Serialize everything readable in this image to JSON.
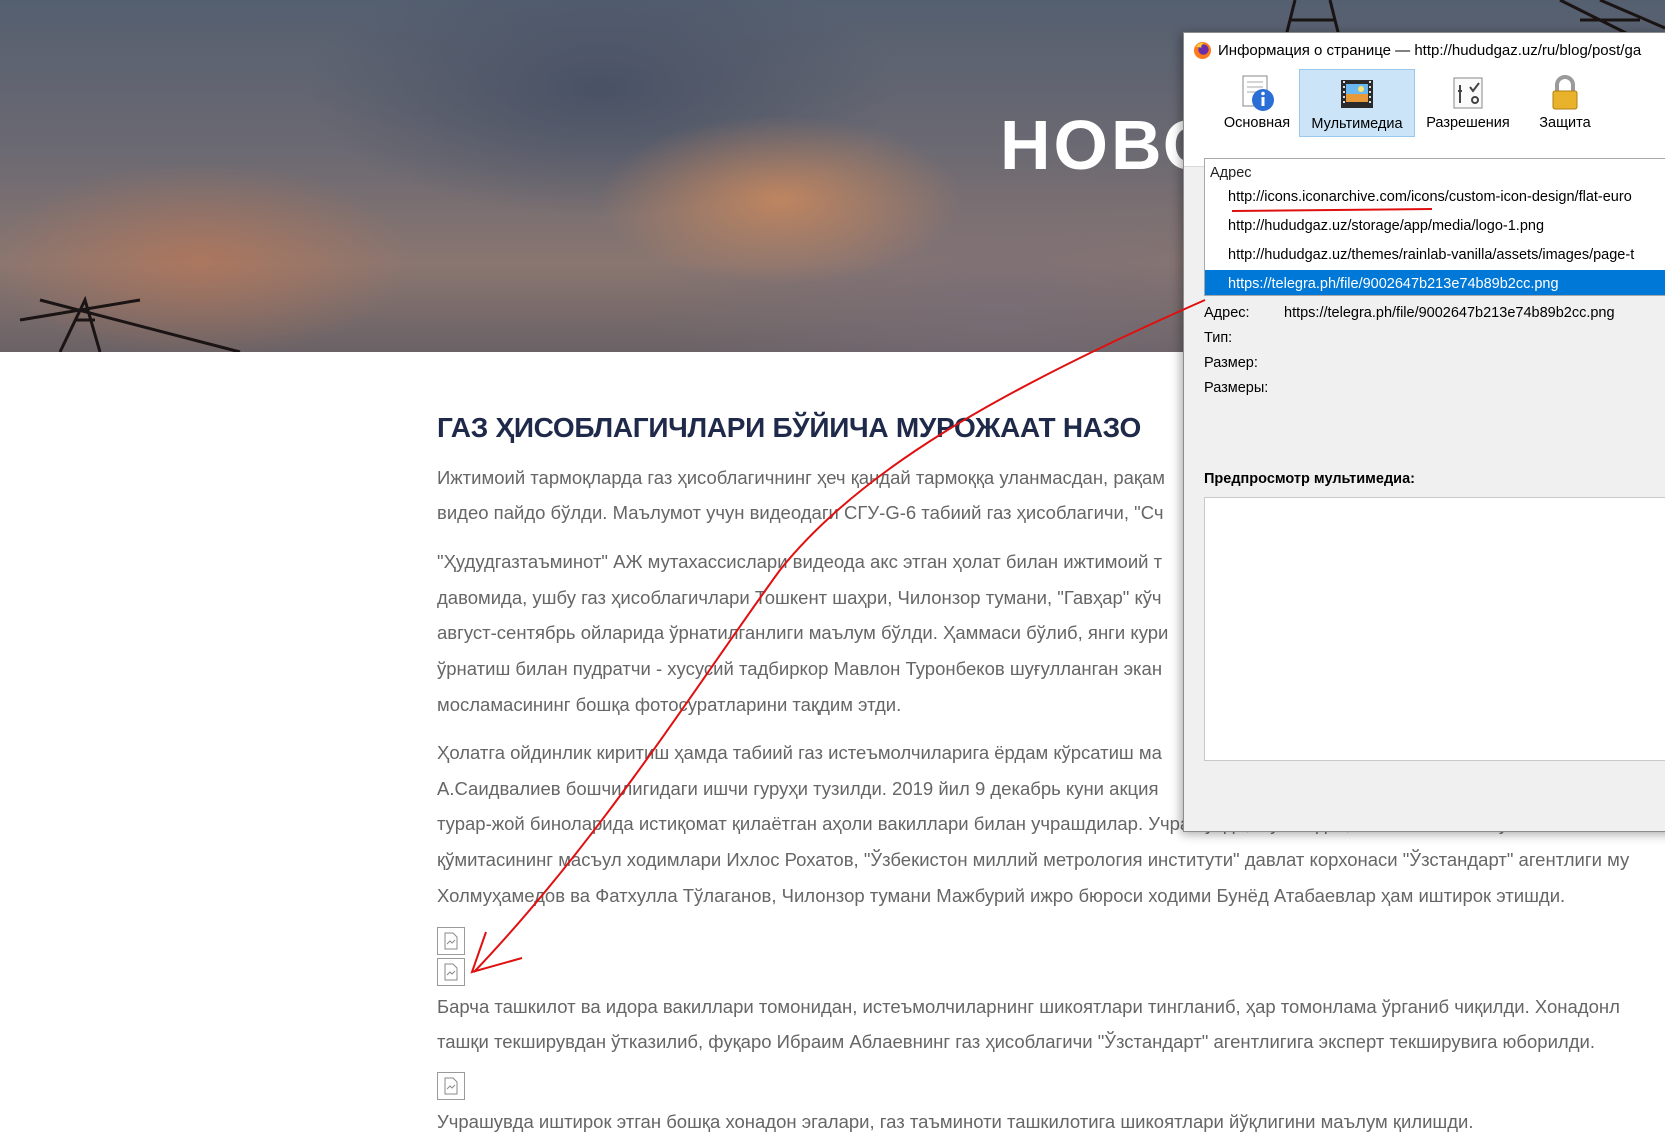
{
  "hero": {
    "title": "НОВО"
  },
  "article": {
    "title": "ГАЗ ҲИСОБЛАГИЧЛАРИ БЎЙИЧА МУРОЖААТ НАЗО",
    "lines": [
      "Ижтимоий тармоқларда газ ҳисоблагичнинг ҳеч қандай тармоққа уланмасдан, рақам",
      "видео пайдо бўлди. Маълумот учун видеодаги СГУ-G-6 табиий газ ҳисоблагичи, \"Сч",
      "\"Ҳудудгазтаъминот\" АЖ мутахассислари видеода акс этган ҳолат билан ижтимоий т",
      "давомида, ушбу газ ҳисоблагичлари Тошкент шаҳри, Чилонзор тумани, \"Гавҳар\" кўч",
      "август-сентябрь ойларида ўрнатилганлиги маълум бўлди. Ҳаммаси бўлиб, янги кури",
      "ўрнатиш билан пудратчи - хусусий тадбиркор Мавлон Туронбеков шуғулланган экан",
      "мосламасининг бошқа фотосуратларини тақдим этди.",
      "Ҳолатга ойдинлик киритиш ҳамда табиий газ истеъмолчиларига ёрдам кўрсатиш ма",
      "А.Саидвалиев бошчилигидаги ишчи гуруҳи тузилди. 2019 йил 9 декабрь куни акция",
      "турар-жой биноларида истиқомат қилаётган аҳоли вакиллари билан учрашдилар. Учрашувда, шунингдек, Ўзбекистон Республикаси Мон",
      "қўмитасининг масъул ходимлари Ихлос Рохатов, \"Ўзбекистон миллий метрология институти\" давлат корхонаси \"Ўзстандарт\" агентлиги му",
      "Холмуҳамедов ва Фатхулла Тўлаганов, Чилонзор тумани Мажбурий ижро бюроси ходими Бунёд Атабаевлар ҳам иштирок этишди.",
      "Барча ташкилот ва идора вакиллари томонидан, истеъмолчиларнинг шикоятлари тингланиб, ҳар томонлама ўрганиб чиқилди. Хонадонл",
      "ташқи текширувдан ўтказилиб, фуқаро Ибраим Аблаевнинг газ ҳисоблагичи \"Ўзстандарт\" агентлигига эксперт текширувига юборилди.",
      "Учрашувда иштирок этган бошқа хонадон эгалари, газ таъминоти ташкилотига шикоятлари йўқлигини маълум қилишди."
    ]
  },
  "dialog": {
    "title": "Информация о странице — http://hududgaz.uz/ru/blog/post/ga",
    "tabs": [
      "Основная",
      "Мультимедиа",
      "Разрешения",
      "Защита"
    ],
    "list_header": "Адрес",
    "list_items": [
      "http://icons.iconarchive.com/icons/custom-icon-design/flat-euro",
      "http://hududgaz.uz/storage/app/media/logo-1.png",
      "http://hududgaz.uz/themes/rainlab-vanilla/assets/images/page-t",
      "https://telegra.ph/file/9002647b213e74b89b2cc.png"
    ],
    "props": {
      "address_label": "Адрес:",
      "address_value": "https://telegra.ph/file/9002647b213e74b89b2cc.png",
      "type_label": "Тип:",
      "size_label": "Размер:",
      "dims_label": "Размеры:"
    },
    "preview_label": "Предпросмотр мультимедиа:"
  },
  "colors": {
    "selection": "#0078d7",
    "annotation": "#e01010",
    "title": "#1f2a4a"
  }
}
